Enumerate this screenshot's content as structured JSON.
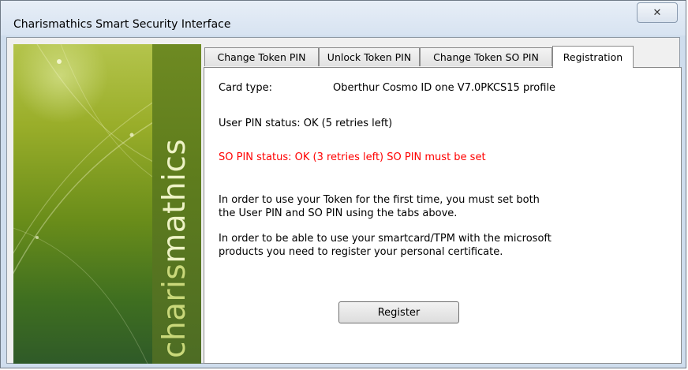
{
  "window": {
    "title": "Charismathics Smart Security Interface",
    "close_glyph": "✕"
  },
  "brand": {
    "part1": "charis",
    "part2": "mathics"
  },
  "tabs": [
    {
      "label": "Change Token PIN"
    },
    {
      "label": "Unlock Token PIN"
    },
    {
      "label": "Change Token SO PIN"
    },
    {
      "label": "Registration",
      "active": true
    }
  ],
  "registration": {
    "card_type_label": "Card type:",
    "card_type_value": "Oberthur Cosmo ID one V7.0PKCS15 profile",
    "user_pin_status": "User PIN status: OK (5 retries left)",
    "so_pin_status": "SO PIN status: OK (3 retries left)  SO PIN must be set",
    "info1_line1": "In order to use your Token for the first time, you must set both",
    "info1_line2": "the User PIN and SO PIN using the tabs above.",
    "info2_line1": "In order to be able to use your smartcard/TPM with the microsoft",
    "info2_line2": "products you need to register your personal certificate.",
    "register_button": "Register"
  },
  "colors": {
    "warning_text": "#ff0000",
    "brand_green": "#6e8a22"
  }
}
